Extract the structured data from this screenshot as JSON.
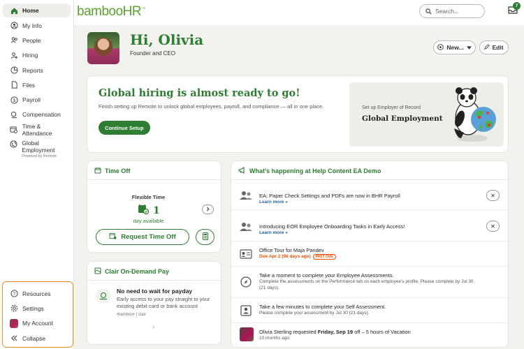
{
  "sidebar": {
    "items": [
      {
        "label": "Home",
        "icon": "home-icon"
      },
      {
        "label": "My Info",
        "icon": "user-circle-icon"
      },
      {
        "label": "People",
        "icon": "people-icon"
      },
      {
        "label": "Hiring",
        "icon": "hiring-icon"
      },
      {
        "label": "Reports",
        "icon": "pie-chart-icon"
      },
      {
        "label": "Files",
        "icon": "file-icon"
      },
      {
        "label": "Payroll",
        "icon": "dollar-icon"
      },
      {
        "label": "Compensation",
        "icon": "compensation-icon"
      },
      {
        "label": "Time & Attendance",
        "icon": "calendar-clock-icon"
      },
      {
        "label": "Global Employment",
        "sublabel": "Powered by Remote",
        "icon": "globe-icon"
      }
    ],
    "bottom": [
      {
        "label": "Resources",
        "icon": "help-icon"
      },
      {
        "label": "Settings",
        "icon": "gear-icon"
      },
      {
        "label": "My Account",
        "icon": "avatar"
      },
      {
        "label": "Collapse",
        "icon": "collapse-icon"
      }
    ]
  },
  "header": {
    "logo": "bambooHR",
    "logo_mark": "™",
    "search_placeholder": "Search...",
    "inbox_count": "7"
  },
  "profile": {
    "greeting": "Hi, Olivia",
    "role": "Founder and CEO",
    "new_label": "New...",
    "edit_label": "Edit"
  },
  "hiring_card": {
    "title": "Global hiring is almost ready to go!",
    "description": "Finish setting up Remote to unlock global employees, payroll, and compliance — all in one place.",
    "button": "Continue Setup",
    "promo_small": "Set up Employer of Record",
    "promo_big": "Global Employment"
  },
  "time_off": {
    "title": "Time Off",
    "policy": "Flexible Time",
    "value": "1",
    "unit": "day available",
    "request_button": "Request Time Off"
  },
  "clair": {
    "title": "Clair On-Demand Pay",
    "heading": "No need to wait for payday",
    "description": "Early access to your pay straight to your existing debit card or bank account",
    "brands": "•bamboo•  |  clair"
  },
  "news": {
    "title": "What's happening at Help Content EA Demo",
    "items": [
      {
        "title": "EA: Paper Check Settings and PDFs are now in BHR Payroll",
        "link": "Learn more »"
      },
      {
        "title": "Introducing EOR Employee Onboarding Tasks in Early Access!",
        "link": "Learn more »"
      },
      {
        "title": "Office Tour for Maja Pandev",
        "due": "Due Apr 2 (98 days ago)",
        "badge": "PAST DUE"
      },
      {
        "title": "Take a moment to complete your Employee Assessments.",
        "sub": "Complete the assessments on the Performance tab on each employee's profile. Please complete by Jul 30 (21 days)."
      },
      {
        "title": "Take a few minutes to complete your Self Assessment.",
        "sub": "Please complete your assessment by Jul 30 (21 days)."
      },
      {
        "title_pre": "Olivia Sterling requested ",
        "title_bold": "Friday, Sep 19",
        "title_post": " off – 5 hours of Vacation",
        "sub": "10 months ago"
      }
    ]
  },
  "colors": {
    "brand_green": "#2e7d32",
    "logo_green": "#5aa12e",
    "highlight_orange": "#f08c28"
  }
}
